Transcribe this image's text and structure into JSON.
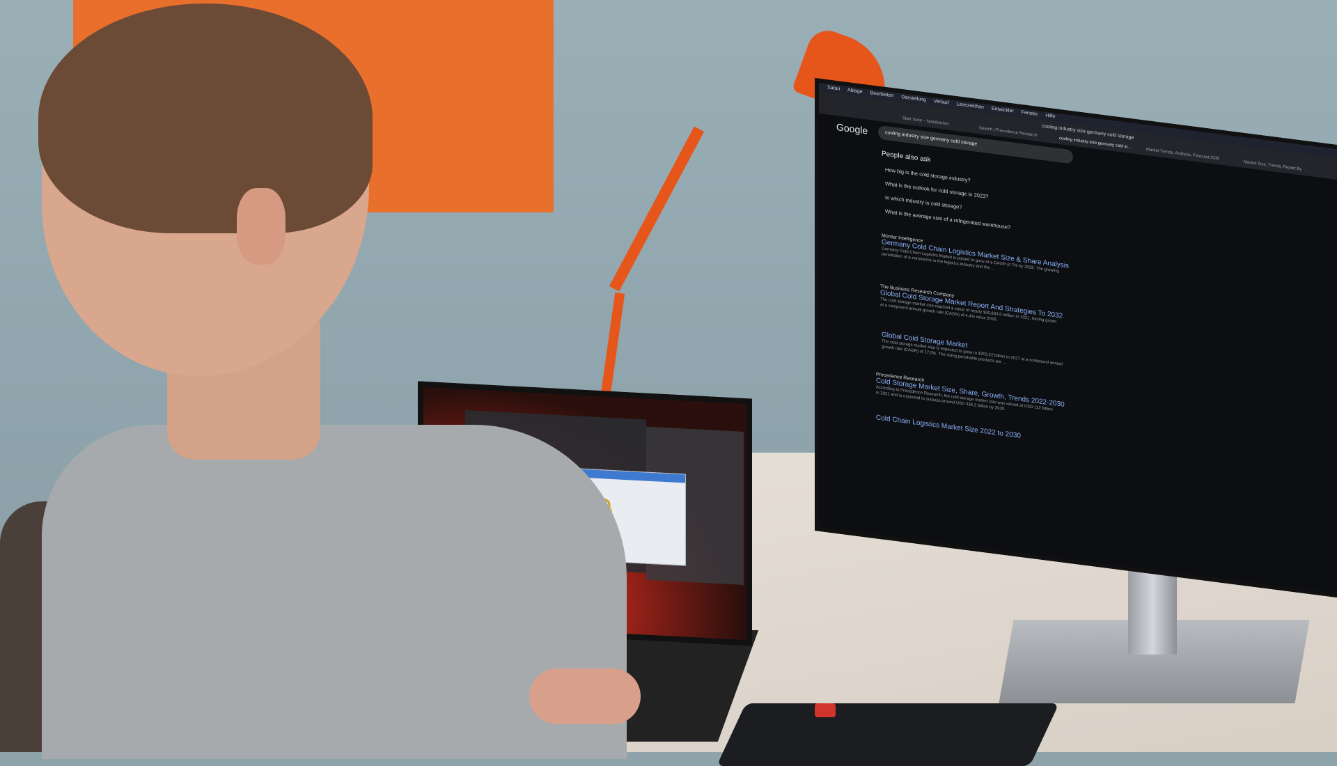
{
  "scene": {
    "colors": {
      "wall": "#8fa3ab",
      "poster": "#e9702c",
      "lamp": "#e6561b",
      "desk": "#e0d8cf",
      "monitor_screen": "#0d0e12"
    }
  },
  "monitor": {
    "menubar": [
      "Safari",
      "Ablage",
      "Bearbeiten",
      "Darstellung",
      "Verlauf",
      "Lesezeichen",
      "Entwickler",
      "Fenster",
      "Hilfe"
    ],
    "url": "cooling industry size germany cold storage",
    "tabs": [
      "Start Seite – Notizbücher",
      "Search | Precedence Research",
      "cooling industry size germany cold st...",
      "Market Trends, Analysis, Forecast 2030",
      "Market Size, Trends, Report By"
    ],
    "google_logo": "Google",
    "search_query": "cooling industry size germany cold storage",
    "people_also_ask_title": "People also ask",
    "questions": [
      "How big is the cold storage industry?",
      "What is the outlook for cold storage in 2023?",
      "In which industry is cold storage?",
      "What is the average size of a refrigerated warehouse?"
    ],
    "results": [
      {
        "site": "Mordor Intelligence",
        "title": "Germany Cold Chain Logistics Market Size & Share Analysis",
        "snippet": "Germany Cold Chain Logistics Market is poised to grow at a CAGR of 7% by 2028. The growing penetration of e-commerce in the logistics industry and the ..."
      },
      {
        "site": "The Business Research Company",
        "title": "Global Cold Storage Market Report And Strategies To 2032",
        "snippet": "The cold storage market size reached a value of nearly $30,833.6 million in 2021, having grown at a compound annual growth rate (CAGR) of 4.4% since 2016."
      },
      {
        "site": "",
        "title": "Global Cold Storage Market",
        "snippet": "The cold storage market size is expected to grow to $303.22 billion in 2027 at a compound annual growth rate (CAGR) of 17.0%. The rising perishable products are ..."
      },
      {
        "site": "Precedence Research",
        "title": "Cold Storage Market Size, Share, Growth, Trends 2022-2030",
        "snippet": "According to Precedence Research, the cold storage market size was valued at USD 112 billion in 2021 and is expected to surpass around USD 336.2 billion by 2030."
      },
      {
        "site": "",
        "title": "Cold Chain Logistics Market Size 2022 to 2030",
        "snippet": ""
      }
    ]
  },
  "laptop": {
    "dialog_icon": "lock-icon"
  }
}
